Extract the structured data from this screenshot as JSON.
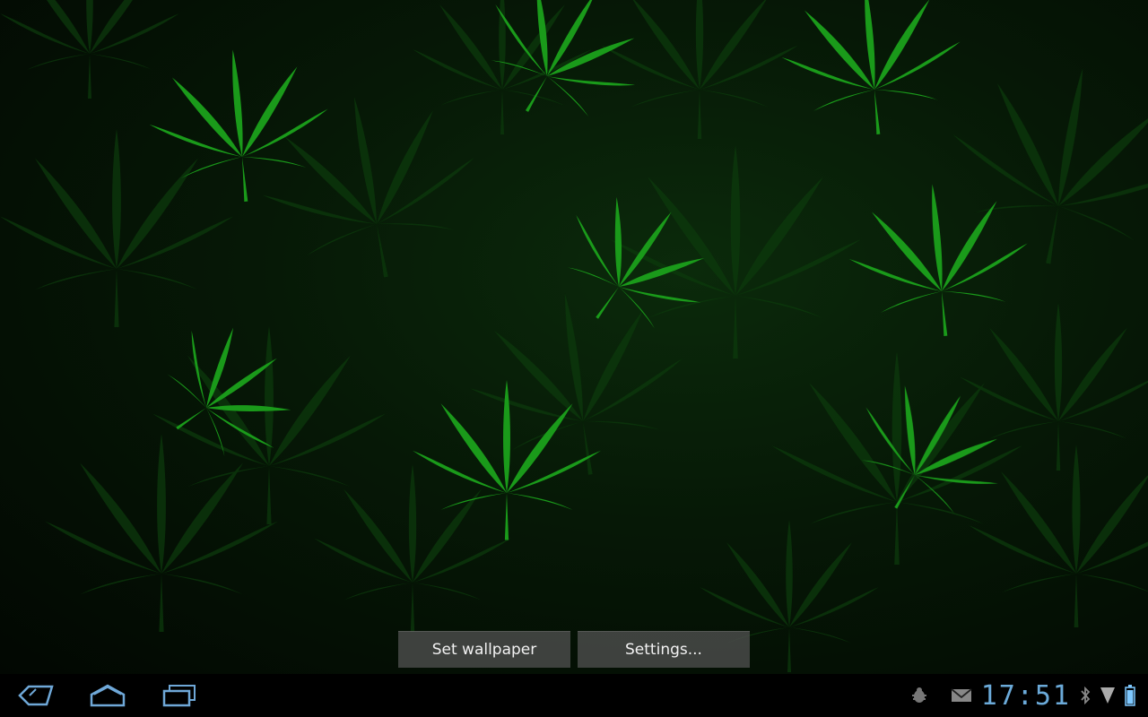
{
  "wallpaper_preview": {
    "set_wallpaper_label": "Set wallpaper",
    "settings_label": "Settings..."
  },
  "system_bar": {
    "clock": "17:51",
    "icons": [
      "back-icon",
      "home-icon",
      "recent-apps-icon",
      "usb-debug-icon",
      "mail-icon",
      "bluetooth-icon",
      "signal-icon",
      "battery-icon"
    ],
    "accent_color": "#7ec8ff"
  },
  "colors": {
    "leaf_bright": "#1a9a1a",
    "leaf_dark": "#0d4a0d",
    "background": "#061806"
  }
}
